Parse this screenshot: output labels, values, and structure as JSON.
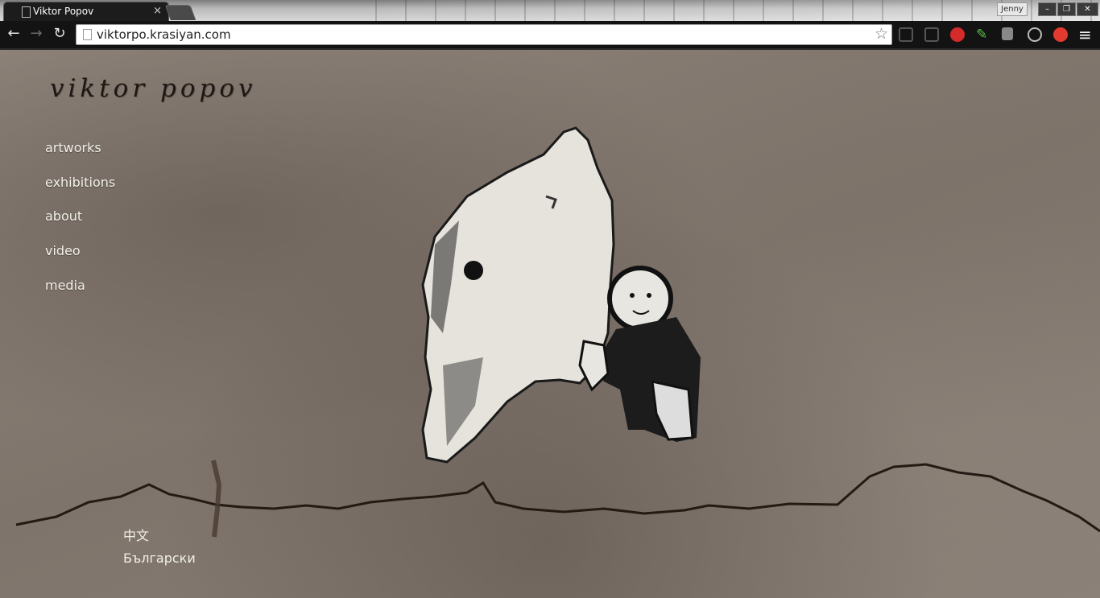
{
  "browser": {
    "tab_title": "Viktor Popov",
    "tab_close": "×",
    "profile_name": "Jenny",
    "url": "viktorpo.krasiyan.com",
    "window_buttons": {
      "minimize": "–",
      "maximize": "❐",
      "close": "✕"
    },
    "nav": {
      "back": "←",
      "forward": "→",
      "reload": "↻",
      "star": "☆",
      "menu": "≡"
    },
    "extensions": [
      "window-icon",
      "window-icon",
      "stop-icon",
      "pen-icon",
      "copy-icon",
      "block-icon",
      "red-extension-icon"
    ]
  },
  "site": {
    "logo": "viktor popov",
    "nav": {
      "artworks": "artworks",
      "exhibitions": "exhibitions",
      "about": "about",
      "video": "video",
      "media": "media"
    },
    "languages": {
      "chinese": "中文",
      "bulgarian": "Български"
    },
    "colors": {
      "text": "#f3f0ea",
      "logo": "#1e1713",
      "wall": "#8c8178"
    }
  }
}
